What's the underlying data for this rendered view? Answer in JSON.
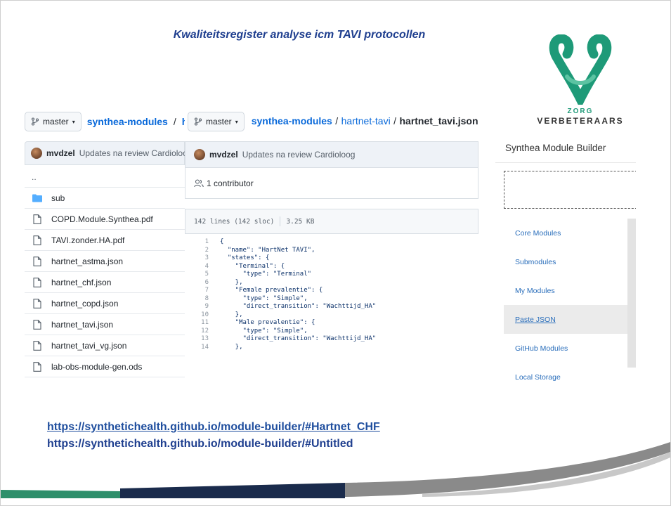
{
  "slide_title": "Kwaliteitsregister analyse icm TAVI protocollen",
  "logo": {
    "line1": "ZORG",
    "line2": "VERBETERAARS",
    "color": "#1e9a78",
    "icon": "ribbon-v-logo"
  },
  "repo_left": {
    "branch": "master",
    "breadcrumb_repo": "synthea-modules",
    "breadcrumb_sep": "/",
    "breadcrumb_trunc": "ha",
    "commit_user": "mvdzel",
    "commit_msg": "Updates na review Cardioloog",
    "up_dir": "..",
    "files": [
      {
        "name": "sub",
        "icon": "folder-icon"
      },
      {
        "name": "COPD.Module.Synthea.pdf",
        "icon": "file-icon"
      },
      {
        "name": "TAVI.zonder.HA.pdf",
        "icon": "file-icon"
      },
      {
        "name": "hartnet_astma.json",
        "icon": "file-icon"
      },
      {
        "name": "hartnet_chf.json",
        "icon": "file-icon"
      },
      {
        "name": "hartnet_copd.json",
        "icon": "file-icon"
      },
      {
        "name": "hartnet_tavi.json",
        "icon": "file-icon"
      },
      {
        "name": "hartnet_tavi_vg.json",
        "icon": "file-icon"
      },
      {
        "name": "lab-obs-module-gen.ods",
        "icon": "file-icon"
      }
    ]
  },
  "repo_mid": {
    "branch": "master",
    "path_repo": "synthea-modules",
    "path_sep1": "/",
    "path_dir": "hartnet-tavi",
    "path_sep2": "/",
    "path_file": "hartnet_tavi.json",
    "commit_user": "mvdzel",
    "commit_msg": "Updates na review Cardioloog",
    "contributors": "1 contributor",
    "lines_info": "142 lines (142 sloc)",
    "size": "3.25 KB",
    "code_lines": [
      {
        "n": "1",
        "t": "{"
      },
      {
        "n": "2",
        "t": "  \"name\": \"HartNet TAVI\","
      },
      {
        "n": "3",
        "t": "  \"states\": {"
      },
      {
        "n": "4",
        "t": "    \"Terminal\": {"
      },
      {
        "n": "5",
        "t": "      \"type\": \"Terminal\""
      },
      {
        "n": "6",
        "t": "    },"
      },
      {
        "n": "7",
        "t": "    \"Female prevalentie\": {"
      },
      {
        "n": "8",
        "t": "      \"type\": \"Simple\","
      },
      {
        "n": "9",
        "t": "      \"direct_transition\": \"Wachttijd_HA\""
      },
      {
        "n": "10",
        "t": "    },"
      },
      {
        "n": "11",
        "t": "    \"Male prevalentie\": {"
      },
      {
        "n": "12",
        "t": "      \"type\": \"Simple\","
      },
      {
        "n": "13",
        "t": "      \"direct_transition\": \"Wachttijd_HA\""
      },
      {
        "n": "14",
        "t": "    },"
      }
    ]
  },
  "module_builder": {
    "title": "Synthea Module Builder",
    "nav": [
      {
        "label": "Core Modules",
        "active": false
      },
      {
        "label": "Submodules",
        "active": false
      },
      {
        "label": "My Modules",
        "active": false
      },
      {
        "label": "Paste JSON",
        "active": true
      },
      {
        "label": "GitHub Modules",
        "active": false
      },
      {
        "label": "Local Storage",
        "active": false
      }
    ]
  },
  "links": {
    "link1": "https://synthetichealth.github.io/module-builder/#Hartnet_CHF",
    "link2": "https://synthetichealth.github.io/module-builder/#Untitled"
  },
  "colors": {
    "link_blue": "#0969da",
    "title_blue": "#1f3f8f",
    "swoosh_green": "#2e8f6b",
    "swoosh_navy": "#1a2b4c",
    "swoosh_gray": "#8a8a8a"
  }
}
